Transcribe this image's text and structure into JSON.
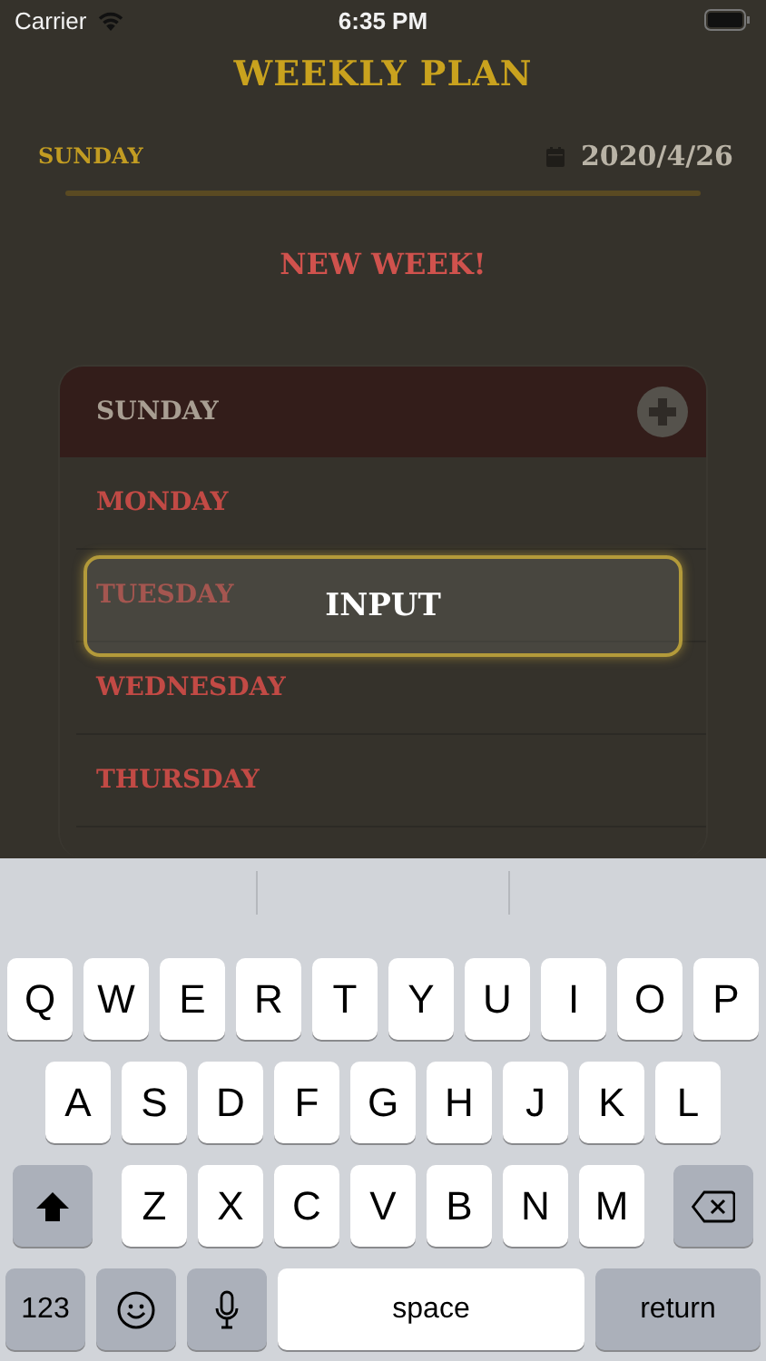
{
  "status_bar": {
    "carrier": "Carrier",
    "time": "6:35 PM"
  },
  "title": "WEEKLY PLAN",
  "current_day": "SUNDAY",
  "date": "2020/4/26",
  "new_week_button": "NEW WEEK!",
  "days": [
    {
      "label": "SUNDAY",
      "selected": true
    },
    {
      "label": "MONDAY",
      "selected": false
    },
    {
      "label": "TUESDAY",
      "selected": false
    },
    {
      "label": "WEDNESDAY",
      "selected": false
    },
    {
      "label": "THURSDAY",
      "selected": false
    }
  ],
  "input_dialog": {
    "label": "INPUT"
  },
  "keyboard": {
    "top_row": [
      {
        "kind": "letter",
        "label": "Q"
      },
      {
        "kind": "letter",
        "label": "W"
      },
      {
        "kind": "letter",
        "label": "E"
      },
      {
        "kind": "letter",
        "label": "R"
      },
      {
        "kind": "letter",
        "label": "T"
      },
      {
        "kind": "letter",
        "label": "Y"
      },
      {
        "kind": "letter",
        "label": "U"
      },
      {
        "kind": "letter",
        "label": "I"
      },
      {
        "kind": "letter",
        "label": "O"
      },
      {
        "kind": "letter",
        "label": "P"
      }
    ],
    "middle_row": [
      {
        "kind": "letter",
        "label": "A"
      },
      {
        "kind": "letter",
        "label": "S"
      },
      {
        "kind": "letter",
        "label": "D"
      },
      {
        "kind": "letter",
        "label": "F"
      },
      {
        "kind": "letter",
        "label": "G"
      },
      {
        "kind": "letter",
        "label": "H"
      },
      {
        "kind": "letter",
        "label": "J"
      },
      {
        "kind": "letter",
        "label": "K"
      },
      {
        "kind": "letter",
        "label": "L"
      }
    ],
    "bottom_row": [
      {
        "kind": "shift"
      },
      {
        "kind": "letter",
        "label": "Z"
      },
      {
        "kind": "letter",
        "label": "X"
      },
      {
        "kind": "letter",
        "label": "C"
      },
      {
        "kind": "letter",
        "label": "V"
      },
      {
        "kind": "letter",
        "label": "B"
      },
      {
        "kind": "letter",
        "label": "N"
      },
      {
        "kind": "letter",
        "label": "M"
      },
      {
        "kind": "delete"
      }
    ],
    "function_row": [
      {
        "kind": "numbers",
        "label": "123"
      },
      {
        "kind": "emoji"
      },
      {
        "kind": "mic"
      },
      {
        "kind": "space",
        "label": "space"
      },
      {
        "kind": "return",
        "label": "return"
      }
    ]
  }
}
